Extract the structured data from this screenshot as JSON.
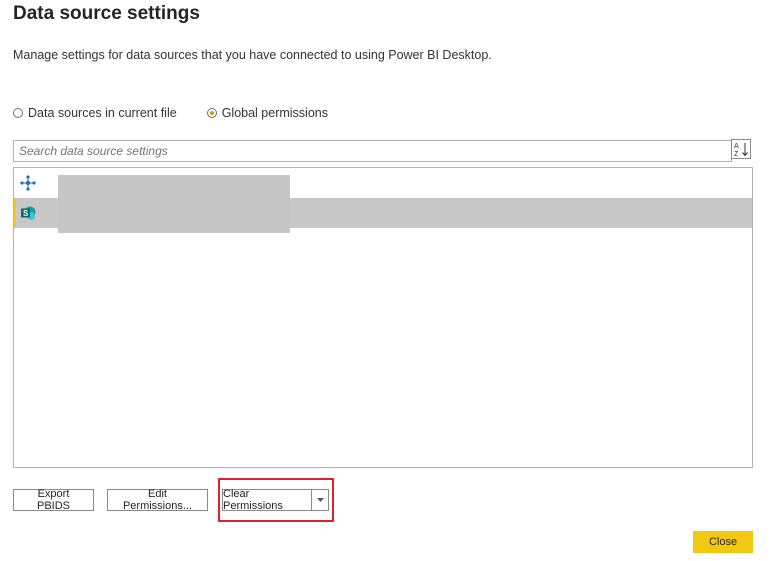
{
  "dialog": {
    "title": "Data source settings",
    "description": "Manage settings for data sources that you have connected to using Power BI Desktop."
  },
  "scope": {
    "options": [
      {
        "label": "Data sources in current file",
        "selected": false
      },
      {
        "label": "Global permissions",
        "selected": true
      }
    ]
  },
  "search": {
    "placeholder": "Search data source settings",
    "value": ""
  },
  "sort": {
    "icon": "sort-az-icon"
  },
  "sources": [
    {
      "icon": "web-connector-icon",
      "selected": false
    },
    {
      "icon": "sharepoint-icon",
      "selected": true
    }
  ],
  "buttons": {
    "export": "Export PBIDS",
    "edit": "Edit Permissions...",
    "clear": "Clear Permissions",
    "close": "Close"
  },
  "colors": {
    "accent": "#f2c811",
    "selection": "#c8c8c8",
    "highlight": "#e0212b",
    "sharepoint": "#036c70"
  }
}
